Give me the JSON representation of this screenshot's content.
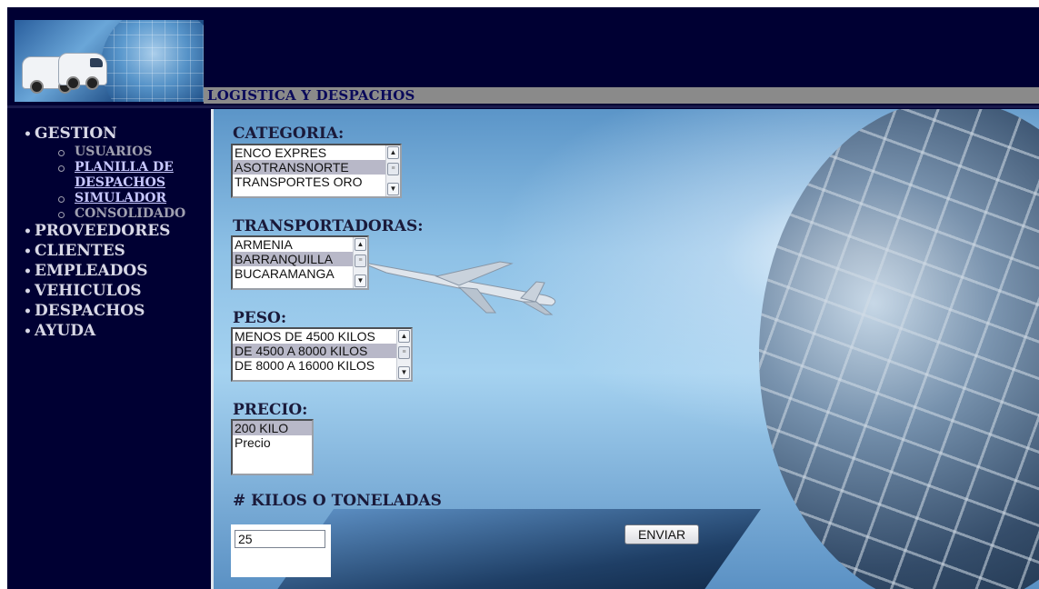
{
  "header": {
    "title": "LOGISTICA Y DESPACHOS"
  },
  "sidebar": {
    "menu": [
      {
        "label": "GESTION",
        "children": [
          {
            "label": "USUARIOS",
            "link": false
          },
          {
            "label": "PLANILLA DE DESPACHOS",
            "link": true
          },
          {
            "label": "SIMULADOR",
            "link": true
          },
          {
            "label": "CONSOLIDADO",
            "link": false
          }
        ]
      },
      {
        "label": "PROVEEDORES"
      },
      {
        "label": "CLIENTES"
      },
      {
        "label": "EMPLEADOS"
      },
      {
        "label": "VEHICULOS"
      },
      {
        "label": "DESPACHOS"
      },
      {
        "label": "AYUDA"
      }
    ]
  },
  "form": {
    "categoria": {
      "label": "CATEGORIA:",
      "options": [
        "ENCO EXPRES",
        "ASOTRANSNORTE",
        "TRANSPORTES ORO"
      ],
      "selected": "ASOTRANSNORTE"
    },
    "transportadoras": {
      "label": "TRANSPORTADORAS:",
      "options": [
        "ARMENIA",
        "BARRANQUILLA",
        "BUCARAMANGA"
      ],
      "selected": "BARRANQUILLA"
    },
    "peso": {
      "label": "PESO:",
      "options": [
        "MENOS DE 4500 KILOS",
        "DE 4500 A 8000 KILOS",
        "DE 8000 A 16000 KILOS"
      ],
      "selected": "DE 4500 A 8000 KILOS"
    },
    "precio": {
      "label": "PRECIO:",
      "options": [
        "200 KILO",
        "Precio"
      ],
      "selected": "200 KILO"
    },
    "kilos": {
      "label": "# KILOS O TONELADAS",
      "value": "25"
    },
    "submit_label": "ENVIAR"
  },
  "colors": {
    "background": "#000033",
    "title_bar": "#8a8a8a",
    "title_text": "#0a0a5a",
    "selected_option": "#b8b8c8"
  }
}
